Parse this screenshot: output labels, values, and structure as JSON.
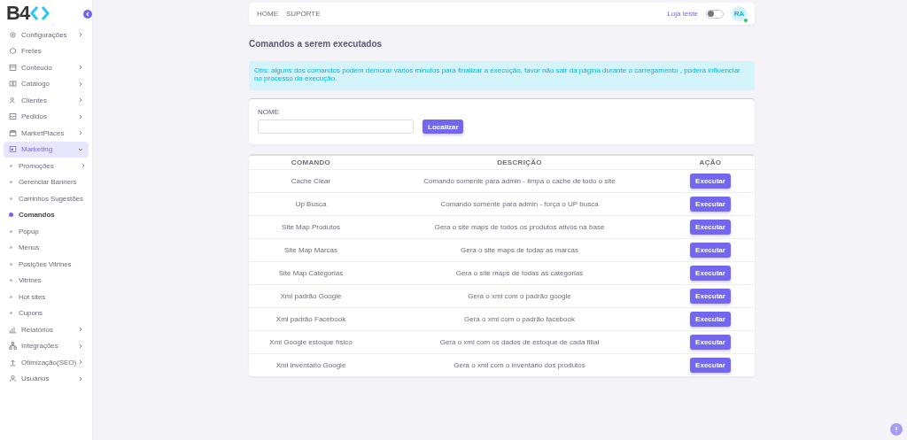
{
  "logo": "B4",
  "menu": [
    {
      "label": "Configurações",
      "has_children": true,
      "expanded": false,
      "selected": false
    },
    {
      "label": "Fretes",
      "has_children": false,
      "expanded": false,
      "selected": false
    },
    {
      "label": "Conteudo",
      "has_children": true,
      "expanded": false,
      "selected": false
    },
    {
      "label": "Catálogo",
      "has_children": true,
      "expanded": false,
      "selected": false
    },
    {
      "label": "Clientes",
      "has_children": true,
      "expanded": false,
      "selected": false
    },
    {
      "label": "Pedidos",
      "has_children": true,
      "expanded": false,
      "selected": false
    },
    {
      "label": "MarketPlaces",
      "has_children": true,
      "expanded": false,
      "selected": false
    },
    {
      "label": "Marketing",
      "has_children": true,
      "expanded": true,
      "selected": true,
      "children": [
        {
          "label": "Promoções",
          "has_children": true,
          "selected": false
        },
        {
          "label": "Gerenciar Banners",
          "has_children": false,
          "selected": false
        },
        {
          "label": "Carrinhos Sugestões",
          "has_children": false,
          "selected": false
        },
        {
          "label": "Comandos",
          "has_children": false,
          "selected": true
        },
        {
          "label": "Popup",
          "has_children": false,
          "selected": false
        },
        {
          "label": "Menus",
          "has_children": false,
          "selected": false
        },
        {
          "label": "Posições Vitrines",
          "has_children": false,
          "selected": false
        },
        {
          "label": "Vitrines",
          "has_children": false,
          "selected": false
        },
        {
          "label": "Hot sites",
          "has_children": false,
          "selected": false
        },
        {
          "label": "Cupons",
          "has_children": false,
          "selected": false
        }
      ]
    },
    {
      "label": "Relatórios",
      "has_children": true,
      "expanded": false,
      "selected": false
    },
    {
      "label": "Integrações",
      "has_children": true,
      "expanded": false,
      "selected": false
    },
    {
      "label": "Otimização(SEO)",
      "has_children": true,
      "expanded": false,
      "selected": false
    },
    {
      "label": "Usuários",
      "has_children": true,
      "expanded": false,
      "selected": false
    }
  ],
  "topbar": {
    "links": [
      "HOME",
      "SUPORTE"
    ],
    "store": "Loja teste",
    "theme_toggle": {
      "on": false
    },
    "avatar": {
      "initials": "RA",
      "online": true
    }
  },
  "title": "Comandos a serem executados",
  "alert": "Obs: alguns dos comandos podem demorar vários minutos para finalizar a execução, favor não sair da página durante o carregamento , poderá influenciar no processo da execução.",
  "search": {
    "label": "NOME",
    "button": "Localizar"
  },
  "table": {
    "columns": [
      "COMANDO",
      "DESCRIÇÃO",
      "AÇÃO"
    ],
    "rows": [
      {
        "command": "Cache Clear",
        "description": "Comando somente para admin - limpa o cache de todo o site",
        "action": "Executar"
      },
      {
        "command": "Up Busca",
        "description": "Comando somente para admin - força o UP busca",
        "action": "Executar"
      },
      {
        "command": "Site Map Produtos",
        "description": "Gera o site maps de todos os produtos ativos na base",
        "action": "Executar"
      },
      {
        "command": "Site Map Marcas",
        "description": "Gera o site maps de todas as marcas",
        "action": "Executar"
      },
      {
        "command": "Site Map Categorias",
        "description": "Gera o site maps de todas as categorias",
        "action": "Executar"
      },
      {
        "command": "Xml padrão Google",
        "description": "Gera o xml com o padrão google",
        "action": "Executar"
      },
      {
        "command": "Xml padrão Facebook",
        "description": "Gera o xml com o padrão facebook",
        "action": "Executar"
      },
      {
        "command": "Xml Google estoque físico",
        "description": "Gera o xml com os dados de estoque de cada filial",
        "action": "Executar"
      },
      {
        "command": "Xml inventario Google",
        "description": "Gera o xml com o inventário dos produtos",
        "action": "Executar"
      }
    ]
  }
}
